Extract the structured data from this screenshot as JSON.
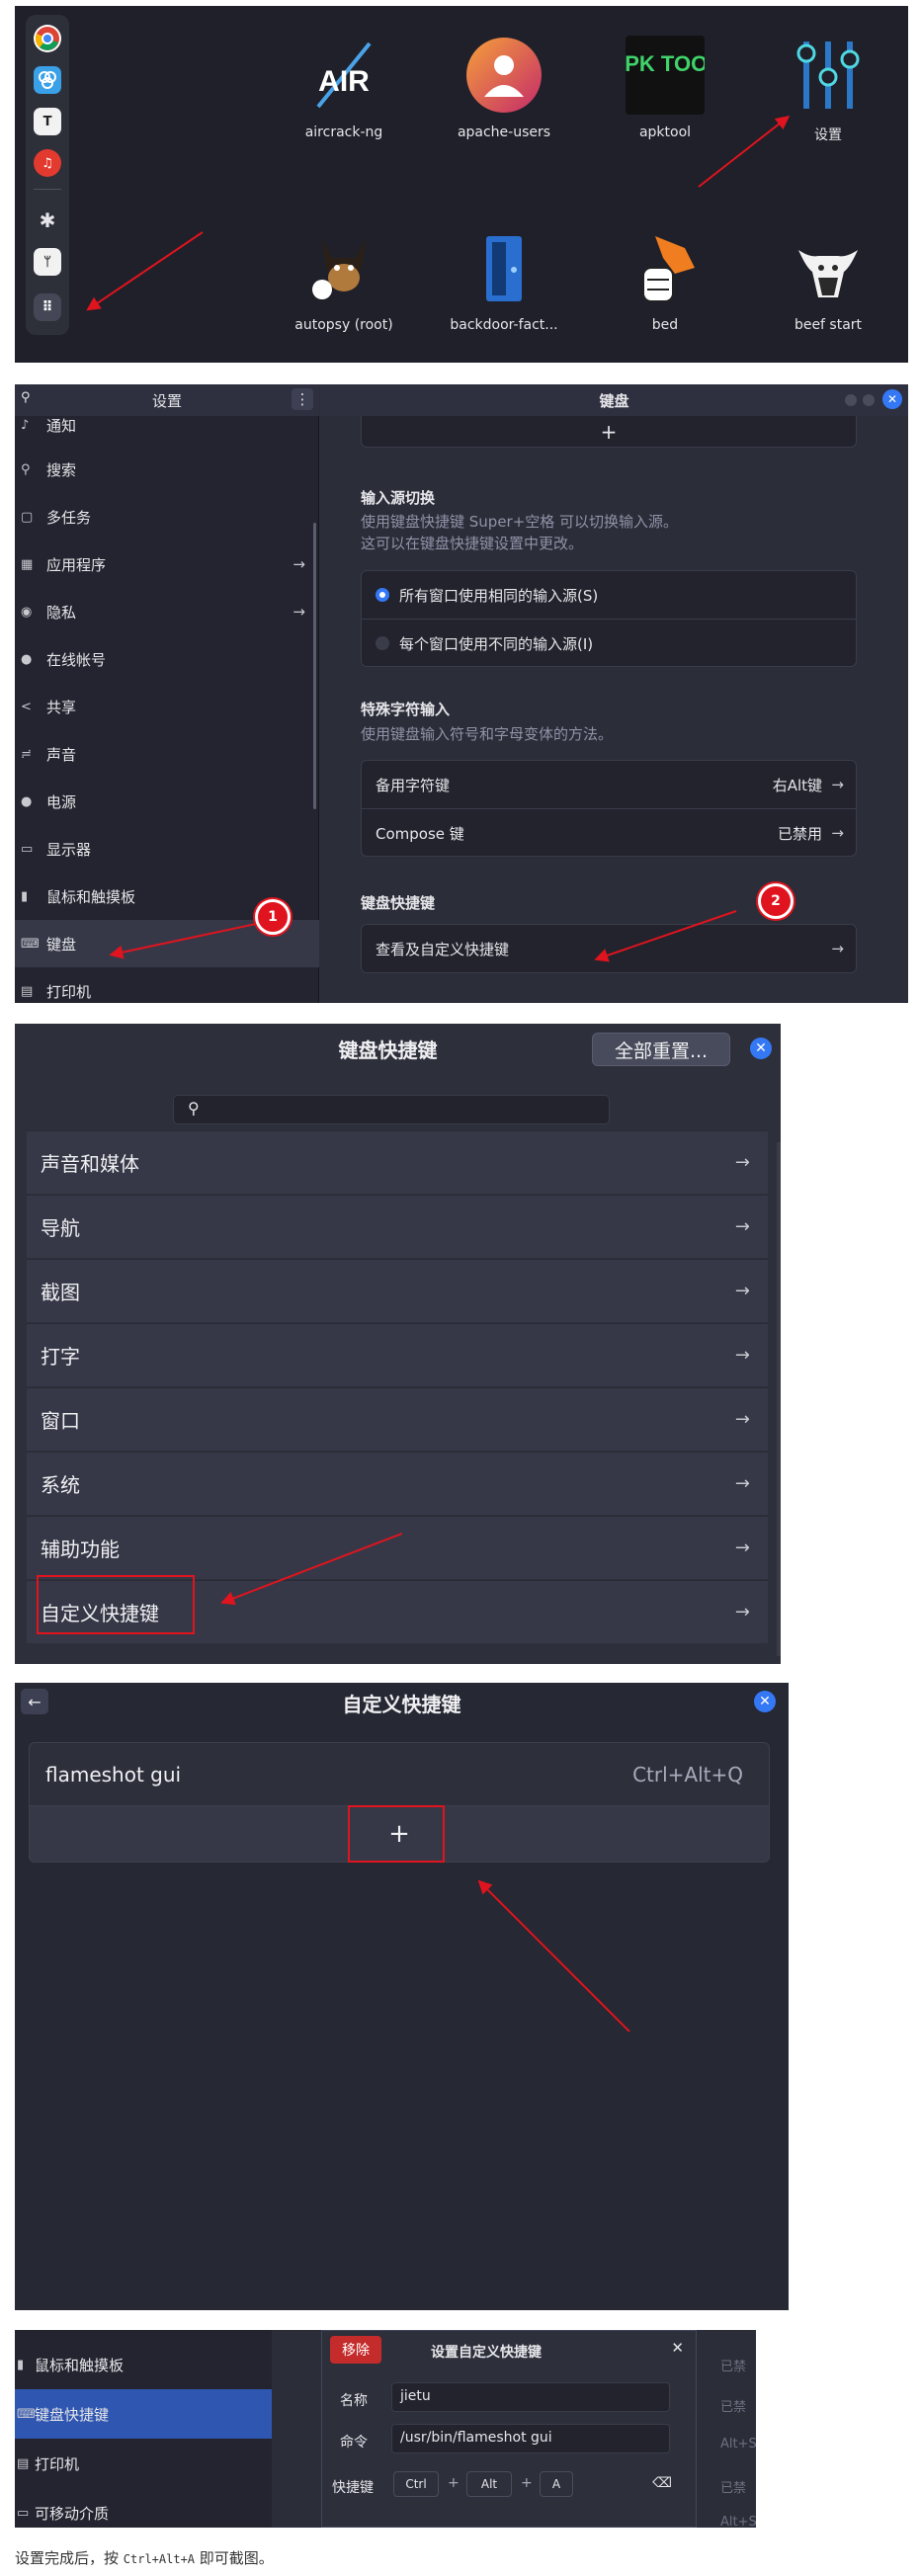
{
  "app_grid": {
    "apps": [
      {
        "label": "aircrack-ng",
        "icon": "aircrack-icon"
      },
      {
        "label": "apache-users",
        "icon": "apache-users-icon"
      },
      {
        "label": "apktool",
        "icon": "apktool-icon"
      },
      {
        "label": "设置",
        "icon": "settings-sliders-icon"
      },
      {
        "label": "autopsy (root)",
        "icon": "autopsy-icon"
      },
      {
        "label": "backdoor-fact...",
        "icon": "backdoor-factory-icon"
      },
      {
        "label": "bed",
        "icon": "bed-icon"
      },
      {
        "label": "beef start",
        "icon": "beef-icon"
      }
    ],
    "aircrack_logo_text": "AIR",
    "apktool_logo_text": "APK TOOL",
    "dock": [
      "chrome-icon",
      "photos-icon",
      "typora-icon",
      "netease-music-icon",
      "gear-icon",
      "usb-icon",
      "app-grid-icon"
    ]
  },
  "settings": {
    "sidebar_title": "设置",
    "content_title": "键盘",
    "sidebar_items": [
      "通知",
      "搜索",
      "多任务",
      "应用程序",
      "隐私",
      "在线帐号",
      "共享",
      "声音",
      "电源",
      "显示器",
      "鼠标和触摸板",
      "键盘",
      "打印机"
    ],
    "add_label": "+",
    "input_switch_title": "输入源切换",
    "input_switch_desc_1": "使用键盘快捷键 Super+空格 可以切换输入源。",
    "input_switch_desc_2": "这可以在键盘快捷键设置中更改。",
    "radio_same": "所有窗口使用相同的输入源(S)",
    "radio_diff": "每个窗口使用不同的输入源(I)",
    "special_title": "特殊字符输入",
    "special_desc": "使用键盘输入符号和字母变体的方法。",
    "alt_char_label": "备用字符键",
    "alt_char_value": "右Alt键",
    "compose_label": "Compose 键",
    "compose_value": "已禁用",
    "shortcuts_title": "键盘快捷键",
    "shortcuts_row": "查看及自定义快捷键",
    "badge_1": "1",
    "badge_2": "2"
  },
  "keyboard_shortcuts": {
    "title": "键盘快捷键",
    "reset_button": "全部重置...",
    "categories": [
      "声音和媒体",
      "导航",
      "截图",
      "打字",
      "窗口",
      "系统",
      "辅助功能",
      "自定义快捷键"
    ]
  },
  "custom_shortcuts": {
    "title": "自定义快捷键",
    "entry_name": "flameshot gui",
    "entry_keys": "Ctrl+Alt+Q",
    "add_label": "+"
  },
  "set_dialog": {
    "sidebar_items": [
      "鼠标和触摸板",
      "键盘快捷键",
      "打印机",
      "可移动介质"
    ],
    "remove_button": "移除",
    "title": "设置自定义快捷键",
    "name_label": "名称",
    "name_value": "jietu",
    "command_label": "命令",
    "command_value": "/usr/bin/flameshot gui",
    "shortcut_label": "快捷键",
    "keys": [
      "Ctrl",
      "Alt",
      "A"
    ],
    "plus": "+",
    "right_values": [
      "已禁",
      "已禁",
      "Alt+S",
      "已禁",
      "Alt+S"
    ]
  },
  "caption": {
    "before": "设置完成后，按 ",
    "code": "Ctrl+Alt+A",
    "after": " 即可截图。"
  },
  "colors": {
    "accent": "#3478f6",
    "annotation": "#e0141e",
    "selected": "#2f56b0"
  }
}
